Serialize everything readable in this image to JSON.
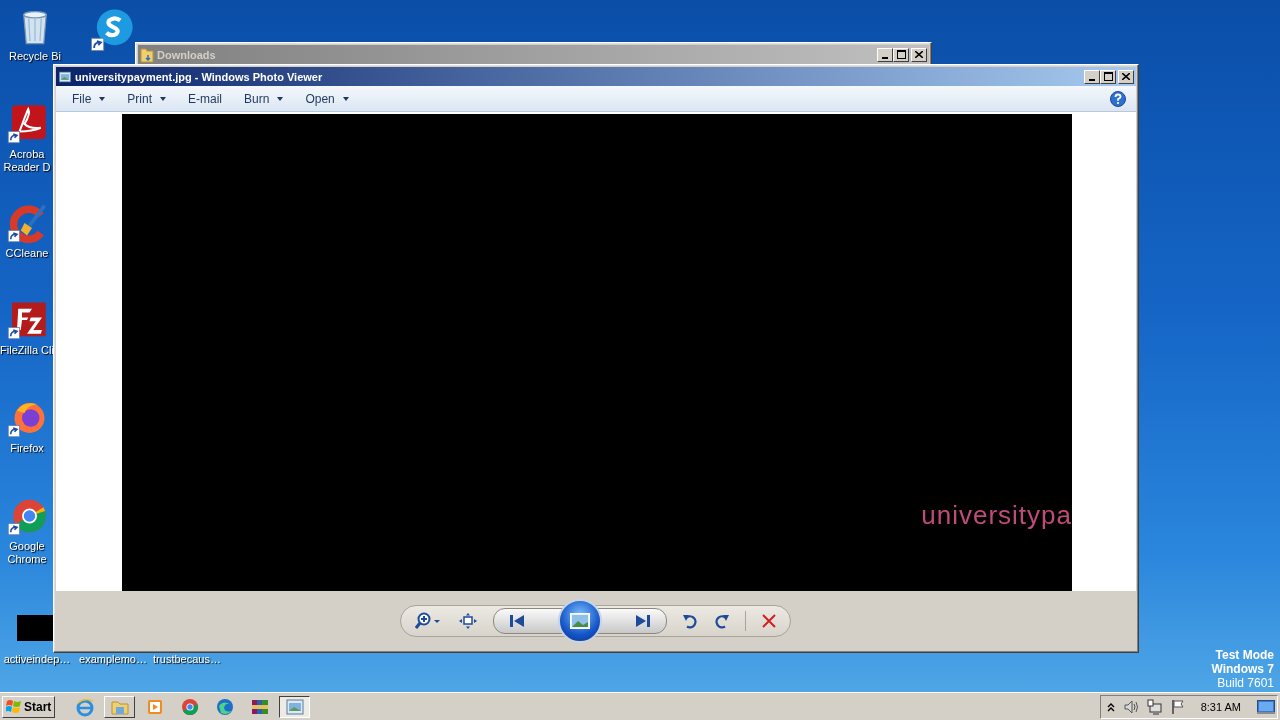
{
  "desktop": {
    "icons": [
      {
        "kind": "recycle-bin",
        "label": "Recycle Bi"
      },
      {
        "kind": "skype"
      },
      {
        "kind": "acrobat",
        "label": "Acroba Reader D"
      },
      {
        "kind": "ccleaner",
        "label": "CCleane"
      },
      {
        "kind": "filezilla",
        "label": "FileZilla Cli"
      },
      {
        "kind": "firefox",
        "label": "Firefox"
      },
      {
        "kind": "chrome",
        "label": "Google Chrome"
      },
      {
        "kind": "file",
        "label": "activeindep…"
      },
      {
        "kind": "hidden",
        "label": "examplemo…"
      },
      {
        "kind": "hidden",
        "label": "trustbecaus…"
      }
    ],
    "os_notice": [
      "Test Mode",
      "Windows 7",
      "Build 7601"
    ]
  },
  "downloads_window": {
    "title": "Downloads"
  },
  "photo_viewer": {
    "title": "universitypayment.jpg - Windows Photo Viewer",
    "menu": [
      {
        "label": "File",
        "dropdown": true
      },
      {
        "label": "Print",
        "dropdown": true
      },
      {
        "label": "E-mail",
        "dropdown": false
      },
      {
        "label": "Burn",
        "dropdown": true
      },
      {
        "label": "Open",
        "dropdown": true
      }
    ],
    "image_text": "universitypa"
  },
  "taskbar": {
    "start": "Start",
    "buttons": [
      {
        "kind": "ie",
        "open": false,
        "selected": false
      },
      {
        "kind": "explorer",
        "open": true,
        "selected": false
      },
      {
        "kind": "media",
        "open": false,
        "selected": false
      },
      {
        "kind": "chrome",
        "open": false,
        "selected": false
      },
      {
        "kind": "edge",
        "open": false,
        "selected": false
      },
      {
        "kind": "winrar",
        "open": false,
        "selected": false
      },
      {
        "kind": "photo",
        "open": true,
        "selected": true
      }
    ],
    "clock": "8:31 AM"
  }
}
